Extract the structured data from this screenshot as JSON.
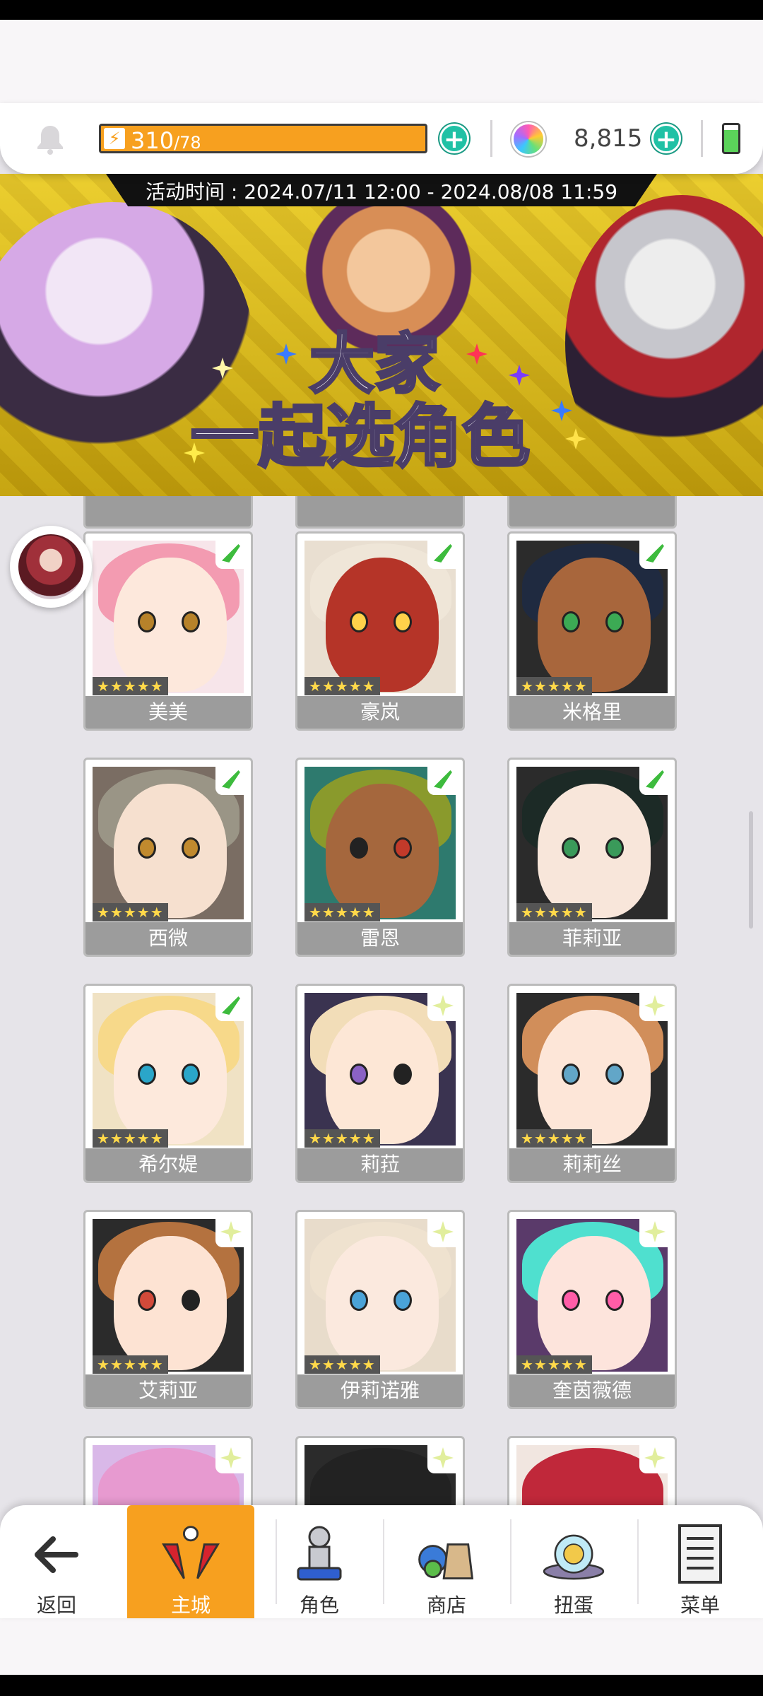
{
  "resources": {
    "stamina_current": "310",
    "stamina_max": "/78",
    "stamina_icon": "lightning-icon",
    "gems": "8,815"
  },
  "banner": {
    "event_time": "活动时间 : 2024.07/11 12:00 - 2024.08/08 11:59",
    "title_line1": "大家",
    "title_line2": "一起选角色"
  },
  "characters": [
    {
      "name": "美美",
      "stars": "★★★★★",
      "element": "wind"
    },
    {
      "name": "豪岚",
      "stars": "★★★★★",
      "element": "wind"
    },
    {
      "name": "米格里",
      "stars": "★★★★★",
      "element": "wind"
    },
    {
      "name": "西微",
      "stars": "★★★★★",
      "element": "wind"
    },
    {
      "name": "雷恩",
      "stars": "★★★★★",
      "element": "wind"
    },
    {
      "name": "菲莉亚",
      "stars": "★★★★★",
      "element": "wind"
    },
    {
      "name": "希尔媞",
      "stars": "★★★★★",
      "element": "wind"
    },
    {
      "name": "莉菈",
      "stars": "★★★★★",
      "element": "light"
    },
    {
      "name": "莉莉丝",
      "stars": "★★★★★",
      "element": "light"
    },
    {
      "name": "艾莉亚",
      "stars": "★★★★★",
      "element": "light"
    },
    {
      "name": "伊莉诺雅",
      "stars": "★★★★★",
      "element": "light"
    },
    {
      "name": "奎茵薇德",
      "stars": "★★★★★",
      "element": "light"
    }
  ],
  "bottom_nav": {
    "back": "返回",
    "main_city": "主城",
    "characters": "角色",
    "shop": "商店",
    "gacha": "扭蛋",
    "menu": "菜单"
  }
}
